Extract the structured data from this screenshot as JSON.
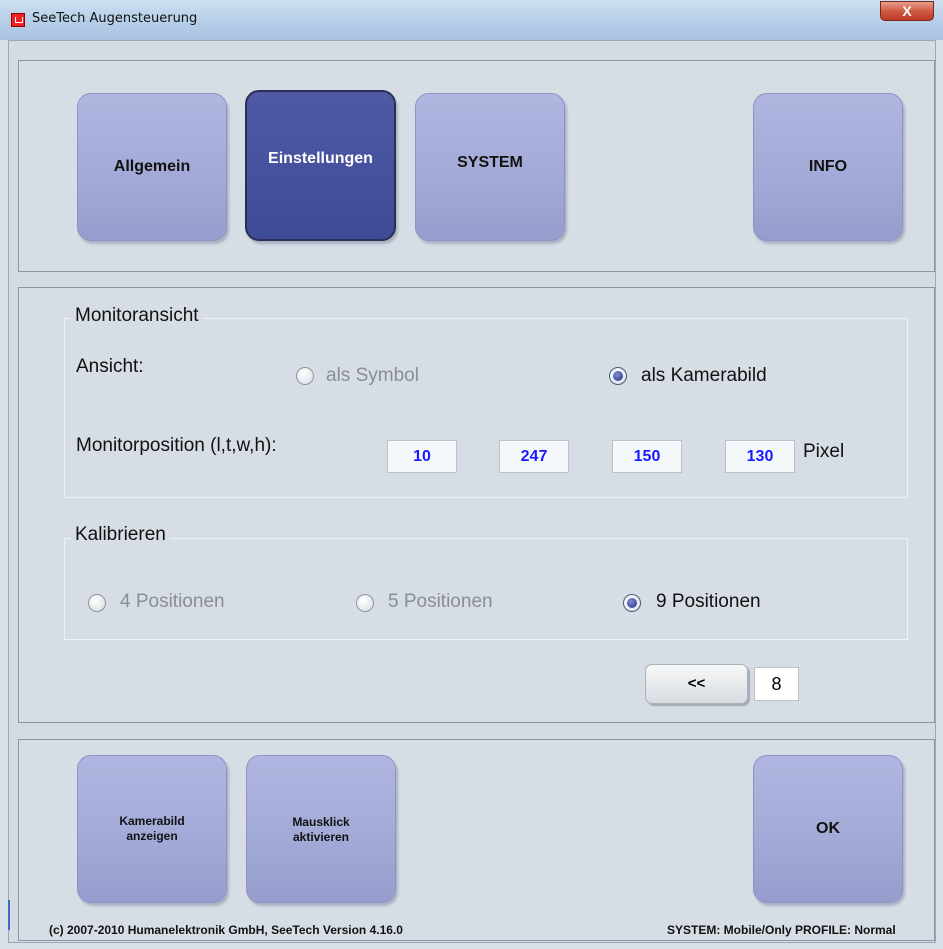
{
  "window": {
    "title": "SeeTech Augensteuerung",
    "close_glyph": "X"
  },
  "nav": {
    "allgemein": "Allgemein",
    "einstellungen": "Einstellungen",
    "system": "SYSTEM",
    "info": "INFO",
    "active": "Einstellungen"
  },
  "monitor": {
    "legend": "Monitoransicht",
    "ansicht_label": "Ansicht:",
    "option_symbol": "als Symbol",
    "option_kamerabild": "als Kamerabild",
    "selected": "als Kamerabild",
    "position_label": "Monitorposition (l,t,w,h):",
    "l": "10",
    "t": "247",
    "w": "150",
    "h": "130",
    "unit": "Pixel"
  },
  "calibrate": {
    "legend": "Kalibrieren",
    "option_4": "4 Positionen",
    "option_5": "5 Positionen",
    "option_9": "9 Positionen",
    "selected": "9 Positionen"
  },
  "pager": {
    "prev_label": "<<",
    "page": "8"
  },
  "bottom": {
    "kamerabild_line1": "Kamerabild",
    "kamerabild_line2": "anzeigen",
    "mausklick_line1": "Mausklick",
    "mausklick_line2": "aktivieren",
    "ok": "OK"
  },
  "status": {
    "copyright": "(c) 2007-2010 Humanelektronik GmbH, SeeTech Version 4.16.0",
    "system_profile": "SYSTEM: Mobile/Only  PROFILE: Normal"
  },
  "colors": {
    "accent": "#3f4b96",
    "button": "#a2a9d6",
    "value_text": "#1a1aff"
  }
}
